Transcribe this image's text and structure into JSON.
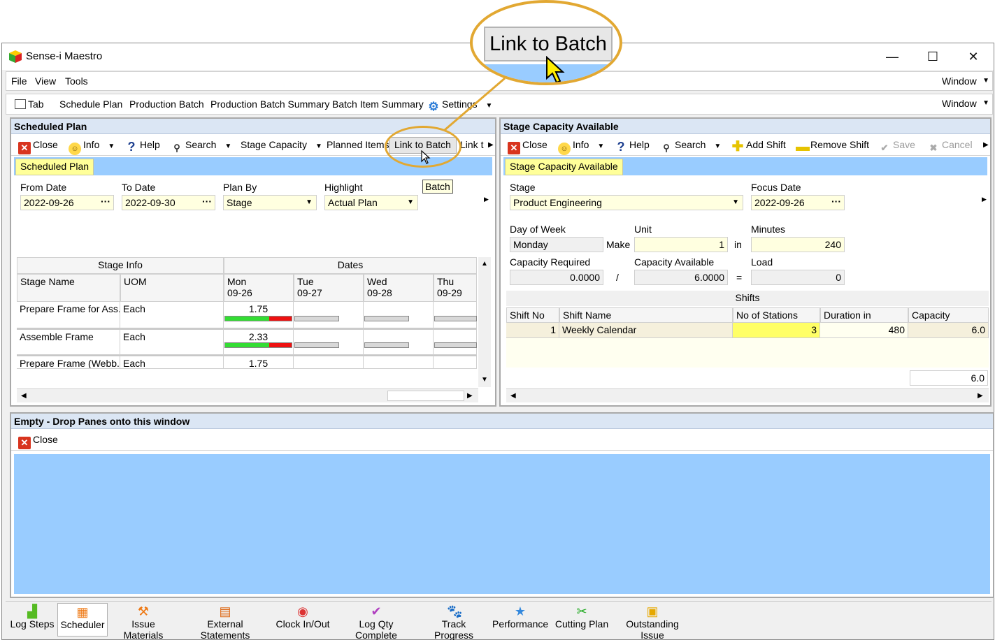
{
  "window": {
    "title": "Sense-i Maestro",
    "min": "—",
    "max": "☐",
    "close": "✕"
  },
  "menubar": {
    "items": [
      "File",
      "View",
      "Tools"
    ],
    "window_dropdown": "Window"
  },
  "toolbar": {
    "items": [
      "Tab",
      "Schedule Plan",
      "Production Batch",
      "Production Batch Summary",
      "Batch Item Summary",
      "Settings"
    ],
    "window_dropdown": "Window"
  },
  "scheduled_plan": {
    "header": "Scheduled Plan",
    "tools": {
      "close": "Close",
      "info": "Info",
      "help": "Help",
      "search": "Search",
      "stage_capacity": "Stage Capacity",
      "planned_items": "Planned Items",
      "link_to_batch": "Link to Batch",
      "link_more": "Link t"
    },
    "tab": "Scheduled Plan",
    "filters": {
      "from_label": "From Date",
      "from_value": "2022-09-26",
      "to_label": "To Date",
      "to_value": "2022-09-30",
      "planby_label": "Plan By",
      "planby_value": "Stage",
      "highlight_label": "Highlight",
      "highlight_value": "Actual Plan"
    },
    "tooltip": "Batch",
    "grid": {
      "group_stage": "Stage Info",
      "group_dates": "Dates",
      "col_stage": "Stage Name",
      "col_uom": "UOM",
      "days": [
        {
          "day": "Mon",
          "date": "09-26"
        },
        {
          "day": "Tue",
          "date": "09-27"
        },
        {
          "day": "Wed",
          "date": "09-28"
        },
        {
          "day": "Thu",
          "date": "09-29"
        }
      ],
      "rows": [
        {
          "stage": "Prepare Frame for Ass...",
          "uom": "Each",
          "mon": "1.75",
          "mon_load": 0.7
        },
        {
          "stage": "Assemble Frame",
          "uom": "Each",
          "mon": "2.33",
          "mon_load": 0.7
        },
        {
          "stage": "Prepare Frame (Webb...",
          "uom": "Each",
          "mon": "1.75"
        }
      ]
    }
  },
  "stage_capacity": {
    "header": "Stage Capacity Available",
    "tools": {
      "close": "Close",
      "info": "Info",
      "help": "Help",
      "search": "Search",
      "add_shift": "Add Shift",
      "remove_shift": "Remove Shift",
      "save": "Save",
      "cancel": "Cancel"
    },
    "tab": "Stage Capacity Available",
    "stage_label": "Stage",
    "stage_value": "Product Engineering",
    "focus_label": "Focus Date",
    "focus_value": "2022-09-26",
    "dow_label": "Day of Week",
    "dow_value": "Monday",
    "make_label": "Make",
    "unit_label": "Unit",
    "unit_value": "1",
    "in_label": "in",
    "minutes_label": "Minutes",
    "minutes_value": "240",
    "req_label": "Capacity Required",
    "req_value": "0.0000",
    "slash": "/",
    "avail_label": "Capacity Available",
    "avail_value": "6.0000",
    "equals": "=",
    "load_label": "Load",
    "load_value": "0",
    "shifts_title": "Shifts",
    "shift_cols": [
      "Shift No",
      "Shift Name",
      "No of Stations",
      "Duration in Minutes",
      "Capacity"
    ],
    "shift_row": {
      "no": "1",
      "name": "Weekly Calendar",
      "stations": "3",
      "duration": "480",
      "capacity": "6.0"
    },
    "total_capacity": "6.0"
  },
  "empty_pane": {
    "header": "Empty - Drop Panes onto this window",
    "close": "Close"
  },
  "dock": [
    "Log Steps",
    "Scheduler",
    "Issue Materials",
    "External Statements",
    "Clock In/Out",
    "Log Qty Complete",
    "Track Progress",
    "Performance",
    "Cutting Plan",
    "Outstanding Issue"
  ],
  "zoom_callout": "Link to Batch",
  "colors": {
    "tab_yellow": "#ffff99",
    "strip_blue": "#99ccff",
    "callout": "#e2a832",
    "close_red": "#d8341e"
  }
}
